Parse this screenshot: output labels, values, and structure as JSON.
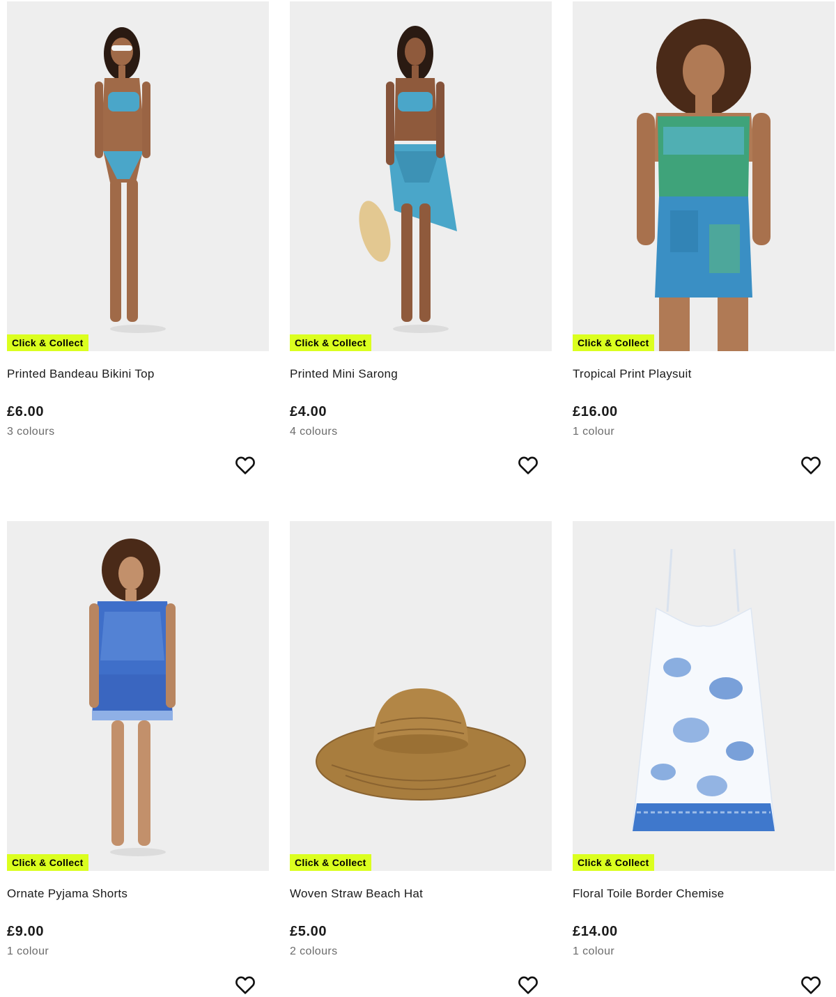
{
  "products": [
    {
      "name": "Printed Bandeau Bikini Top",
      "price": "£6.00",
      "colours": "3 colours",
      "badge": "Click & Collect",
      "image": "woman-wearing-blue-printed-bikini-photo",
      "wishlist_icon": "heart-outline-icon"
    },
    {
      "name": "Printed Mini Sarong",
      "price": "£4.00",
      "colours": "4 colours",
      "badge": "Click & Collect",
      "image": "woman-wearing-printed-sarong-holding-straw-hat-photo",
      "wishlist_icon": "heart-outline-icon"
    },
    {
      "name": "Tropical Print Playsuit",
      "price": "£16.00",
      "colours": "1 colour",
      "badge": "Click & Collect",
      "image": "woman-wearing-green-tropical-playsuit-photo",
      "wishlist_icon": "heart-outline-icon"
    },
    {
      "name": "Ornate Pyjama Shorts",
      "price": "£9.00",
      "colours": "1 colour",
      "badge": "Click & Collect",
      "image": "woman-wearing-blue-pyjama-set-photo",
      "wishlist_icon": "heart-outline-icon"
    },
    {
      "name": "Woven Straw Beach Hat",
      "price": "£5.00",
      "colours": "2 colours",
      "badge": "Click & Collect",
      "image": "straw-beach-hat-photo",
      "wishlist_icon": "heart-outline-icon"
    },
    {
      "name": "Floral Toile Border Chemise",
      "price": "£14.00",
      "colours": "1 colour",
      "badge": "Click & Collect",
      "image": "white-blue-floral-chemise-photo",
      "wishlist_icon": "heart-outline-icon"
    }
  ],
  "colors": {
    "badge_background": "#dbff1f",
    "image_background": "#eeeeee",
    "muted_text": "#6b6b6b"
  }
}
